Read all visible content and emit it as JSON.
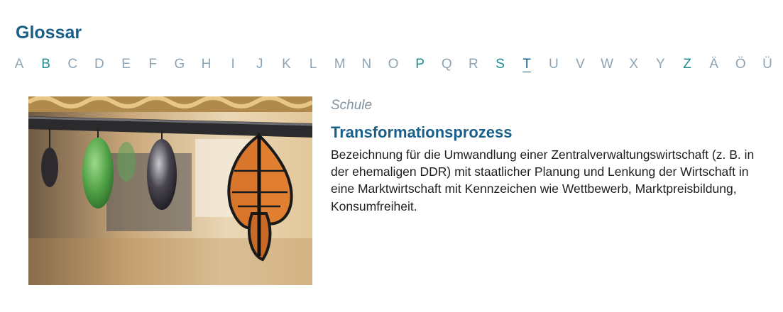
{
  "glossary": {
    "title": "Glossar",
    "letters": [
      {
        "label": "A",
        "state": "disabled"
      },
      {
        "label": "B",
        "state": "active"
      },
      {
        "label": "C",
        "state": "disabled"
      },
      {
        "label": "D",
        "state": "disabled"
      },
      {
        "label": "E",
        "state": "disabled"
      },
      {
        "label": "F",
        "state": "disabled"
      },
      {
        "label": "G",
        "state": "disabled"
      },
      {
        "label": "H",
        "state": "disabled"
      },
      {
        "label": "I",
        "state": "disabled"
      },
      {
        "label": "J",
        "state": "disabled"
      },
      {
        "label": "K",
        "state": "disabled"
      },
      {
        "label": "L",
        "state": "disabled"
      },
      {
        "label": "M",
        "state": "disabled"
      },
      {
        "label": "N",
        "state": "disabled"
      },
      {
        "label": "O",
        "state": "disabled"
      },
      {
        "label": "P",
        "state": "active"
      },
      {
        "label": "Q",
        "state": "disabled"
      },
      {
        "label": "R",
        "state": "disabled"
      },
      {
        "label": "S",
        "state": "active"
      },
      {
        "label": "T",
        "state": "current"
      },
      {
        "label": "U",
        "state": "disabled"
      },
      {
        "label": "V",
        "state": "disabled"
      },
      {
        "label": "W",
        "state": "disabled"
      },
      {
        "label": "X",
        "state": "disabled"
      },
      {
        "label": "Y",
        "state": "disabled"
      },
      {
        "label": "Z",
        "state": "active"
      },
      {
        "label": "Ä",
        "state": "disabled"
      },
      {
        "label": "Ö",
        "state": "disabled"
      },
      {
        "label": "Ü",
        "state": "disabled"
      }
    ]
  },
  "entry": {
    "category": "Schule",
    "title": "Transformationsprozess",
    "text": "Bezeichnung für die Umwandlung einer Zentralverwaltungswirtschaft (z. B. in der ehemaligen DDR) mit staatlicher Planung und Lenkung der Wirtschaft in eine Marktwirtschaft mit Kennzeichen wie Wettbewerb, Marktpreisbildung, Konsumfreiheit."
  },
  "colors": {
    "brand": "#1a5f8a",
    "letter_active": "#1f8c8f",
    "letter_disabled": "#8ea4b4",
    "category": "#8393a0"
  }
}
